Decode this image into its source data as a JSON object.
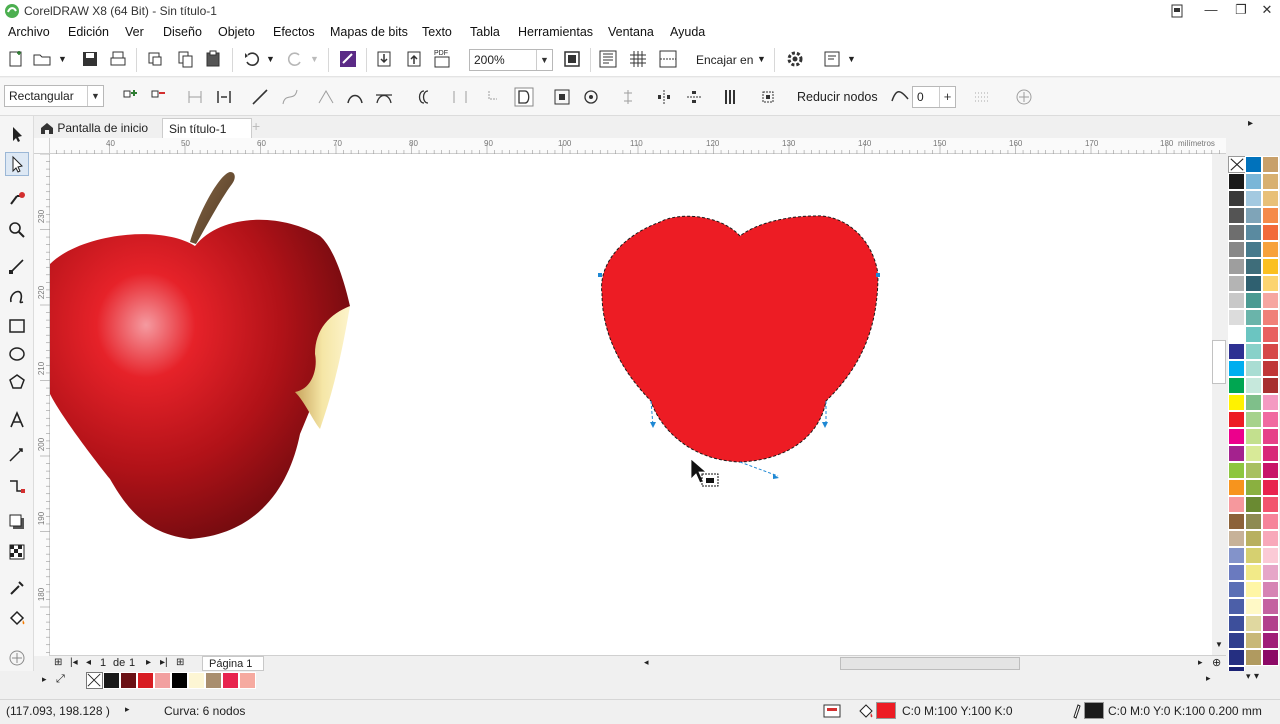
{
  "window": {
    "title": "CorelDRAW X8 (64 Bit) - Sin título-1"
  },
  "menu": [
    "Archivo",
    "Edición",
    "Ver",
    "Diseño",
    "Objeto",
    "Efectos",
    "Mapas de bits",
    "Texto",
    "Tabla",
    "Herramientas",
    "Ventana",
    "Ayuda"
  ],
  "toolbar1": {
    "zoom_value": "200%",
    "snap_label": "Encajar en",
    "pdf_label": "PDF"
  },
  "toolbar2": {
    "shape_mode": "Rectangular",
    "reduce_nodes_label": "Reducir nodos",
    "smoothing_value": "0"
  },
  "tabs": {
    "home": "Pantalla de inicio",
    "doc": "Sin título-1"
  },
  "ruler": {
    "unit": "milímetros",
    "h_ticks": [
      "40",
      "50",
      "60",
      "70",
      "80",
      "90",
      "100",
      "110",
      "120",
      "130",
      "140",
      "150",
      "160",
      "170",
      "180"
    ],
    "v_ticks": [
      "230",
      "220",
      "210",
      "200",
      "190",
      "180"
    ]
  },
  "pagebar": {
    "page_index": "1",
    "page_of": "de",
    "page_total": "1",
    "page_name": "Página 1"
  },
  "status": {
    "coords": "(117.093, 198.128 )",
    "selection": "Curva: 6 nodos",
    "fill_info": "C:0 M:100 Y:100 K:0",
    "outline_info": "C:0 M:0 Y:0 K:100  0.200 mm"
  },
  "colors": {
    "fill_color": "#ed1c24",
    "outline_color": "#1a1a1a",
    "node_color": "#1e88d4"
  },
  "doc_palette": [
    "#1a1a1a",
    "#6b1014",
    "#d81c22",
    "#f2a0a0",
    "#000000",
    "#fdf6d4",
    "#a98e6e",
    "#e8244e",
    "#f6aaa0"
  ],
  "palette_col1": [
    "#1a1a1a",
    "#3a3a3a",
    "#545454",
    "#6e6e6e",
    "#888888",
    "#9e9e9e",
    "#b4b4b4",
    "#c8c8c8",
    "#dcdcdc",
    "#ffffff",
    "#2e3192",
    "#00aeef",
    "#00a651",
    "#fff200",
    "#ed1c24",
    "#ec008c",
    "#a4228e",
    "#8dc63f",
    "#f7941d",
    "#f6989d",
    "#8c6239",
    "#c7b299",
    "#8393ca",
    "#6a7abf",
    "#5b6fb5",
    "#4c5fa8",
    "#3d4f9b",
    "#313f8e",
    "#252f81",
    "#1a2174"
  ],
  "palette_col2": [
    "#0072bc",
    "#7ab6d8",
    "#a3c9e0",
    "#7fa4b8",
    "#5a8aa0",
    "#467a8c",
    "#3e6d7a",
    "#2f6070",
    "#4a9a92",
    "#6ab4aa",
    "#6bc5c1",
    "#88d1c9",
    "#a9ddd3",
    "#c6e8dc",
    "#7fbf8a",
    "#a6d28c",
    "#c3e08e",
    "#d8ea98",
    "#a8c060",
    "#8ab040",
    "#6a8a32",
    "#8e8a52",
    "#b8b060",
    "#d6d070",
    "#f2ea88",
    "#fff6a6",
    "#fff9c6",
    "#e0d8a0",
    "#c8b878",
    "#b09a60"
  ],
  "palette_col3": [
    "#c8a06a",
    "#d8b070",
    "#e8c078",
    "#f58a4a",
    "#f26a3a",
    "#f7a23c",
    "#fbc020",
    "#fcd470",
    "#f6a6a0",
    "#f08078",
    "#e86060",
    "#d64848",
    "#c03838",
    "#a83030",
    "#f49ac2",
    "#f06aa0",
    "#e64088",
    "#d82878",
    "#c81468",
    "#e8244e",
    "#f2546e",
    "#f6849a",
    "#f8a8ba",
    "#fbcad6",
    "#e6a6c8",
    "#d684b4",
    "#c462a0",
    "#b2408c",
    "#a01e78",
    "#8c0a66"
  ]
}
